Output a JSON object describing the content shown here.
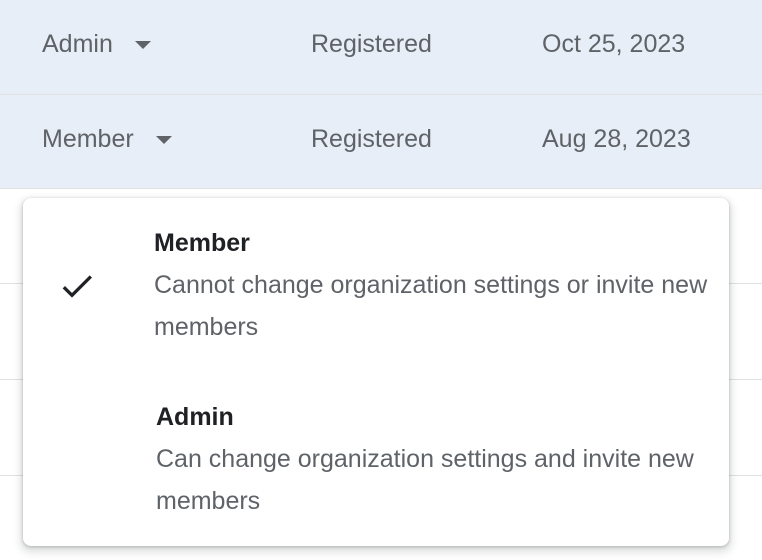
{
  "rows": [
    {
      "role": "Admin",
      "status": "Registered",
      "date": "Oct 25, 2023"
    },
    {
      "role": "Member",
      "status": "Registered",
      "date": "Aug 28, 2023"
    }
  ],
  "role_menu": {
    "options": [
      {
        "title": "Member",
        "description": "Cannot change organization settings or invite new members",
        "selected": true
      },
      {
        "title": "Admin",
        "description": "Can change organization settings and invite new members",
        "selected": false
      }
    ]
  },
  "colors": {
    "selected_row": "#e8eef7",
    "divider": "#dfe1e5",
    "text_secondary": "#5f6368",
    "text_primary": "#202124"
  },
  "icons": {
    "caret": "arrow-drop-down-icon",
    "check": "check-icon"
  }
}
